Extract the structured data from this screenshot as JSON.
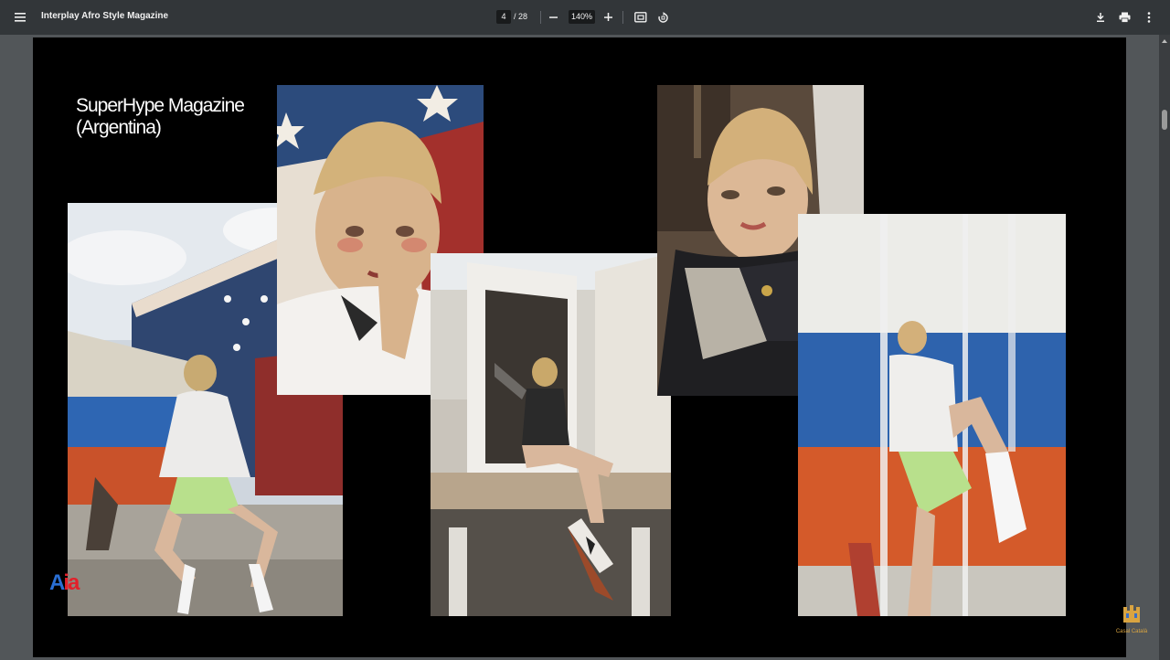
{
  "toolbar": {
    "title": "Interplay Afro Style Magazine",
    "current_page": "4",
    "total_pages": "/ 28",
    "zoom": "140%",
    "icons": [
      "menu-icon",
      "zoom-out-icon",
      "zoom-in-icon",
      "fit-page-icon",
      "rotate-icon",
      "download-icon",
      "print-icon",
      "more-vert-icon"
    ]
  },
  "page": {
    "heading_line1": "SuperHype Magazine",
    "heading_line2": "(Argentina)",
    "logo_a": "A",
    "logo_ia": "ia"
  },
  "watermark": {
    "text": "Casal Català"
  },
  "colors": {
    "toolbar_bg": "#323639",
    "viewer_bg": "#525659",
    "page_bg": "#000000",
    "logo_blue": "#2a6fd4",
    "logo_red": "#e3202a"
  }
}
